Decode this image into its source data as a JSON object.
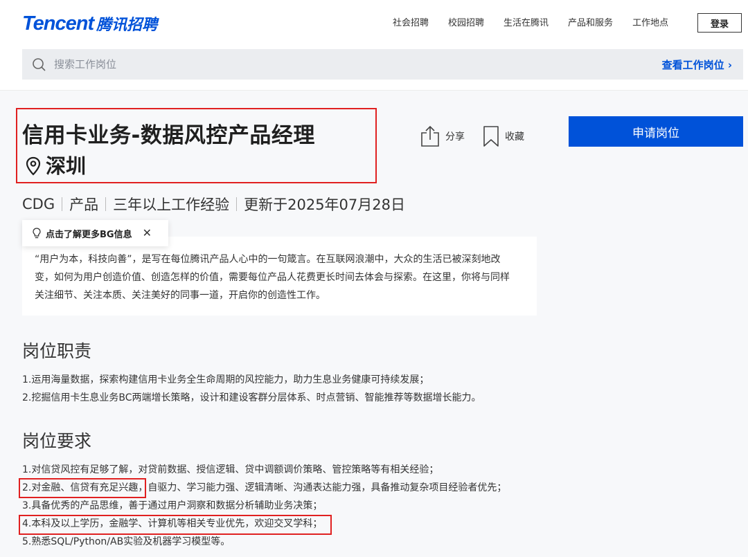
{
  "header": {
    "logo_en": "Tencent",
    "logo_cn": "腾讯招聘",
    "nav": [
      "社会招聘",
      "校园招聘",
      "生活在腾讯",
      "产品和服务",
      "工作地点"
    ],
    "login": "登录"
  },
  "search": {
    "placeholder": "搜索工作岗位",
    "view_jobs": "查看工作岗位 ›"
  },
  "job": {
    "title": "信用卡业务-数据风控产品经理",
    "location": "深圳",
    "meta": [
      "CDG",
      "产品",
      "三年以上工作经验",
      "更新于2025年07月28日"
    ],
    "share": "分享",
    "favorite": "收藏",
    "apply": "申请岗位"
  },
  "tooltip": {
    "text": "点击了解更多BG信息",
    "close": "✕"
  },
  "intro": {
    "lines": [
      "“用户为本，科技向善”，是写在每位腾讯产品人心中的一句箴言。在互联网浪潮中，大众的生活已被深刻地改",
      "变，如何为用户创造价值、创造怎样的价值，需要每位产品人花费更长时间去体会与探索。在这里，你将与同样",
      "关注细节、关注本质、关注美好的同事一道，开启你的创造性工作。"
    ]
  },
  "responsibilities": {
    "title": "岗位职责",
    "items": [
      "1.运用海量数据，探索构建信用卡业务全生命周期的风控能力，助力生息业务健康可持续发展；",
      "2.挖掘信用卡生息业务BC两端增长策略，设计和建设客群分层体系、时点营销、智能推荐等数据增长能力。"
    ]
  },
  "requirements": {
    "title": "岗位要求",
    "items": [
      "1.对信贷风控有足够了解，对贷前数据、授信逻辑、贷中调额调价策略、管控策略等有相关经验；",
      "2.对金融、信贷有充足兴趣，自驱力、学习能力强、逻辑清晰、沟通表达能力强，具备推动复杂项目经验者优先；",
      "3.具备优秀的产品思维，善于通过用户洞察和数据分析辅助业务决策；",
      "4.本科及以上学历，金融学、计算机等相关专业优先，欢迎交叉学科；",
      "5.熟悉SQL/Python/AB实验及机器学习模型等。"
    ]
  },
  "colors": {
    "brand": "#0052d9",
    "highlight": "#e02020"
  }
}
